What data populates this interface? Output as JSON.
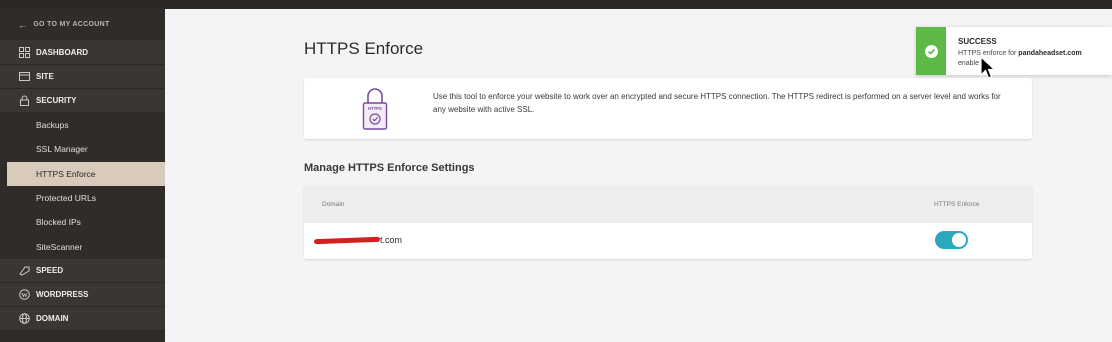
{
  "sidebar": {
    "back_label": "GO TO MY ACCOUNT",
    "items": [
      {
        "label": "DASHBOARD",
        "icon": "dashboard-icon",
        "type": "main"
      },
      {
        "label": "SITE",
        "icon": "site-icon",
        "type": "main"
      },
      {
        "label": "SECURITY",
        "icon": "lock-icon",
        "type": "main"
      },
      {
        "label": "Backups",
        "type": "sub"
      },
      {
        "label": "SSL Manager",
        "type": "sub"
      },
      {
        "label": "HTTPS Enforce",
        "type": "sub",
        "active": true
      },
      {
        "label": "Protected URLs",
        "type": "sub"
      },
      {
        "label": "Blocked IPs",
        "type": "sub"
      },
      {
        "label": "SiteScanner",
        "type": "sub"
      },
      {
        "label": "SPEED",
        "icon": "speed-icon",
        "type": "main"
      },
      {
        "label": "WORDPRESS",
        "icon": "wordpress-icon",
        "type": "main"
      },
      {
        "label": "DOMAIN",
        "icon": "globe-icon",
        "type": "main"
      }
    ]
  },
  "main": {
    "title": "HTTPS Enforce",
    "info_badge": "HTTPS",
    "info_text": "Use this tool to enforce your website to work over an encrypted and secure HTTPS connection. The HTTPS redirect is performed on a server level and works for any website with active SSL.",
    "section_title": "Manage HTTPS Enforce Settings",
    "table": {
      "col_domain": "Domain",
      "col_https": "HTTPS Enforce",
      "rows": [
        {
          "domain_suffix": "t.com",
          "https_enforce": true
        }
      ]
    }
  },
  "toast": {
    "title": "SUCCESS",
    "msg_prefix": "HTTPS enforce for ",
    "msg_domain": "pandaheadset.com",
    "msg_suffix": "enable",
    "color": "#5cb946"
  },
  "colors": {
    "sidebar_bg": "#2f2c2a",
    "active_item": "#d8cbbb",
    "accent_toggle": "#2aa8bd",
    "lock_purple": "#7c4a9e"
  }
}
